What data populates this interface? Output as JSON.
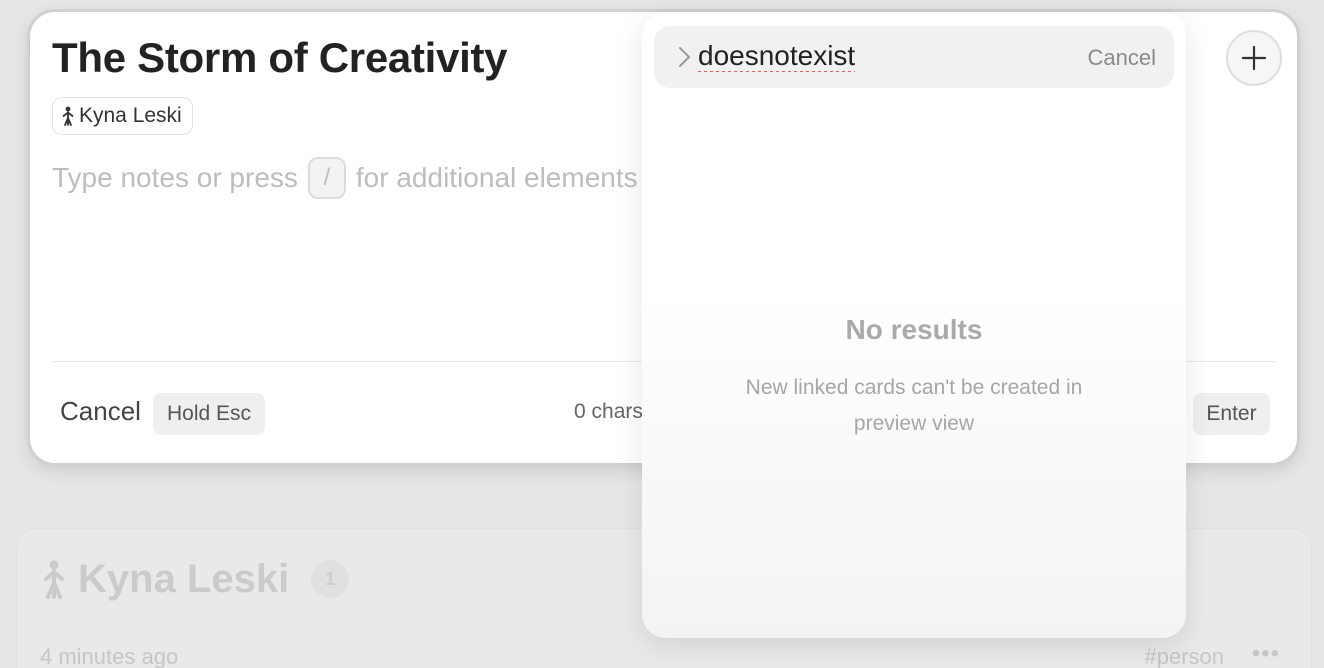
{
  "editor": {
    "title": "The Storm of Creativity",
    "person_chip": {
      "label": "Kyna Leski",
      "icon": "person-icon"
    },
    "placeholder": {
      "before": "Type notes or press",
      "key": "/",
      "after": "for additional elements"
    },
    "footer": {
      "cancel_label": "Cancel",
      "hold_esc_label": "Hold Esc",
      "chars_label": "0 chars",
      "enter_label": "Enter"
    },
    "add_button_icon": "plus-icon"
  },
  "popup": {
    "search": {
      "value": "doesnotexist",
      "cancel_label": "Cancel",
      "chevron_icon": "chevron-right-icon"
    },
    "empty_state": {
      "title": "No results",
      "message": "New linked cards can't be created in preview view"
    }
  },
  "background_card": {
    "title": "Kyna Leski",
    "count": "1",
    "time": "4 minutes ago",
    "tag": "person",
    "more_icon": "more-icon"
  },
  "colors": {
    "title_text": "#222222",
    "muted_text": "#bdbdbd",
    "spellcheck_underline": "#e05050"
  }
}
